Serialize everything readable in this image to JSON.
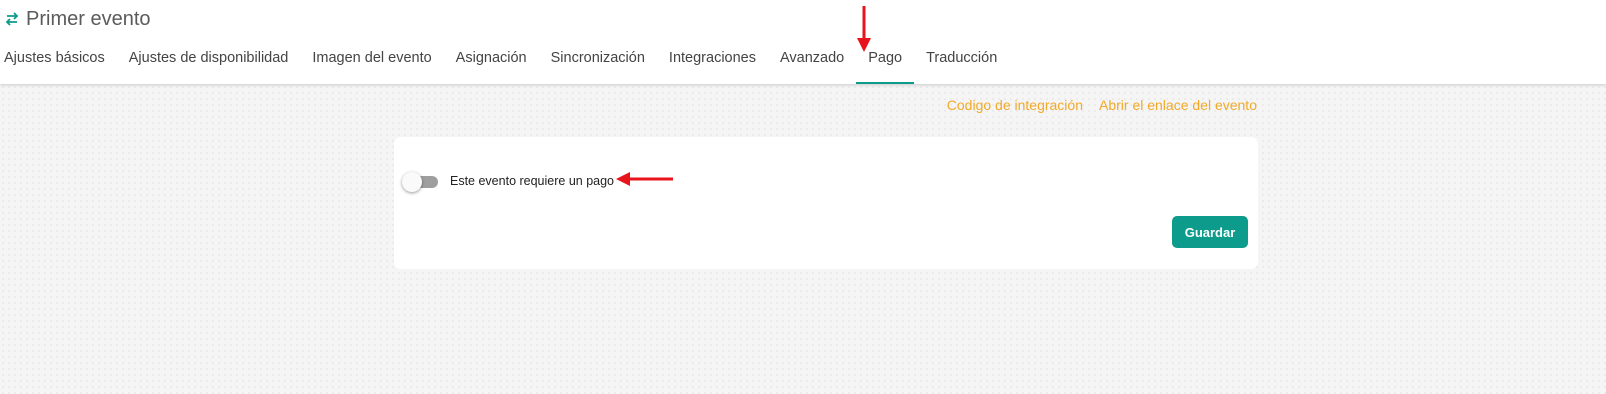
{
  "header": {
    "title": "Primer evento",
    "icon": "swap-arrows-icon"
  },
  "tabs": [
    {
      "label": "Ajustes básicos",
      "active": false
    },
    {
      "label": "Ajustes de disponibilidad",
      "active": false
    },
    {
      "label": "Imagen del evento",
      "active": false
    },
    {
      "label": "Asignación",
      "active": false
    },
    {
      "label": "Sincronización",
      "active": false
    },
    {
      "label": "Integraciones",
      "active": false
    },
    {
      "label": "Avanzado",
      "active": false
    },
    {
      "label": "Pago",
      "active": true
    },
    {
      "label": "Traducción",
      "active": false
    }
  ],
  "links": {
    "integration_code": "Codigo de integración",
    "open_event_link": "Abrir el enlace del evento"
  },
  "payment": {
    "toggle_label": "Este evento requiere un pago",
    "toggle_on": false,
    "save_label": "Guardar"
  },
  "colors": {
    "accent": "#0d9b8c",
    "link": "#f2a928",
    "annotation": "#e8141b"
  }
}
